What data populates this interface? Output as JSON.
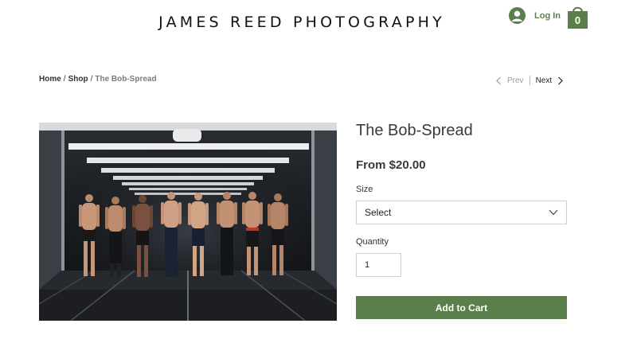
{
  "header": {
    "site_title": "JAMES REED PHOTOGRAPHY",
    "login_label": "Log In",
    "cart_count": "0",
    "accent_color": "#5b7f4a"
  },
  "breadcrumb": {
    "home": "Home",
    "sep1": "/",
    "shop": "Shop",
    "sep2": "/",
    "current": "The Bob-Spread"
  },
  "pager": {
    "prev_label": "Prev",
    "next_label": "Next"
  },
  "product": {
    "title": "The Bob-Spread",
    "price": "From $20.00",
    "image_subject": "group photo of eight shirtless athletes in a dark tunnel",
    "size_label": "Size",
    "size_selected": "Select",
    "quantity_label": "Quantity",
    "quantity_value": "1",
    "add_to_cart_label": "Add to Cart"
  }
}
